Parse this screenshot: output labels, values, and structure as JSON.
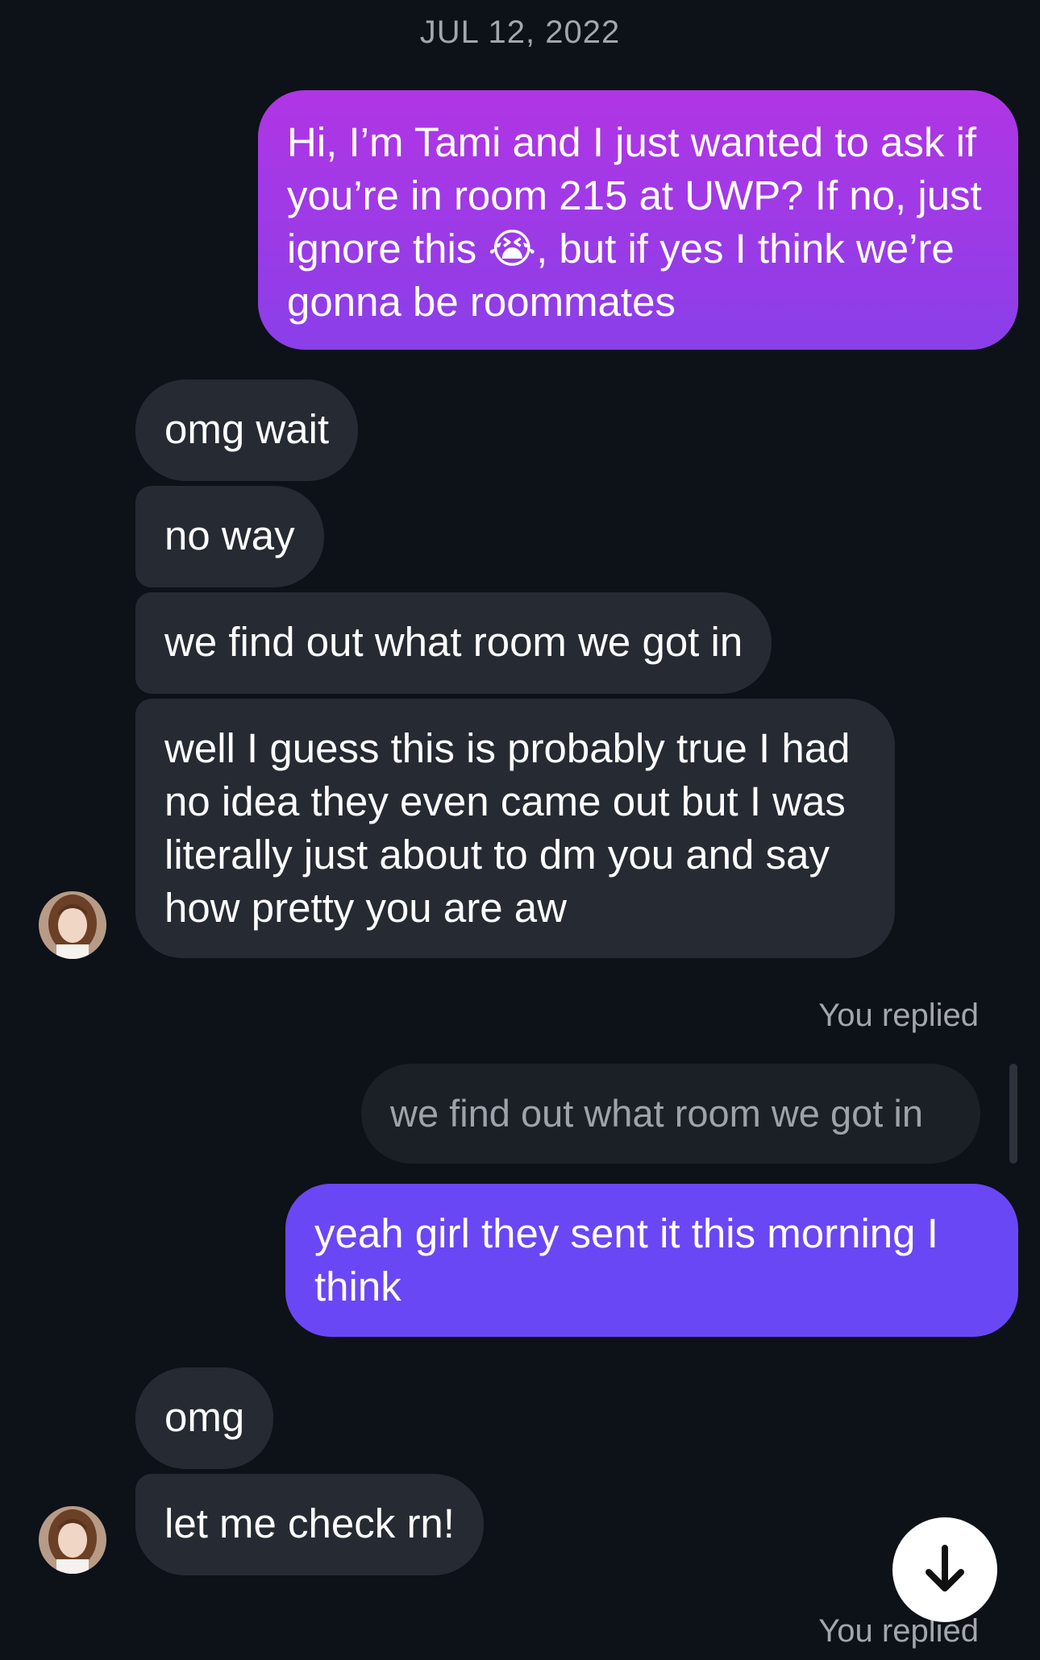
{
  "date_header": "JUL 12, 2022",
  "messages": [
    {
      "from": "me",
      "text": "Hi, I’m Tami and I just wanted to ask if you’re in room 215 at UWP? If no, just ignore this 😭, but if yes I think we’re gonna be roommates"
    },
    {
      "from": "them",
      "text": "omg wait"
    },
    {
      "from": "them",
      "text": "no way"
    },
    {
      "from": "them",
      "text": "we find out what room we got in"
    },
    {
      "from": "them",
      "text": "well I guess this is probably true I had no idea they even came out but I was literally just about to dm you and say how pretty you are aw"
    },
    {
      "from": "me",
      "reply_label": "You replied",
      "quoted": "we find out what room we got in",
      "text": "yeah girl they sent it this morning I think"
    },
    {
      "from": "them",
      "text": "omg"
    },
    {
      "from": "them",
      "text": "let me check rn!"
    }
  ],
  "footer_reply_label": "You replied",
  "colors": {
    "background": "#0d1118",
    "incoming_bubble": "#262a33",
    "outgoing_gradient_top": "#b135e4",
    "outgoing_gradient_bottom": "#8a3fe8",
    "outgoing_solid": "#6a47f4"
  },
  "icons": {
    "scroll_button": "arrow-down-icon",
    "avatar": "contact-avatar"
  }
}
